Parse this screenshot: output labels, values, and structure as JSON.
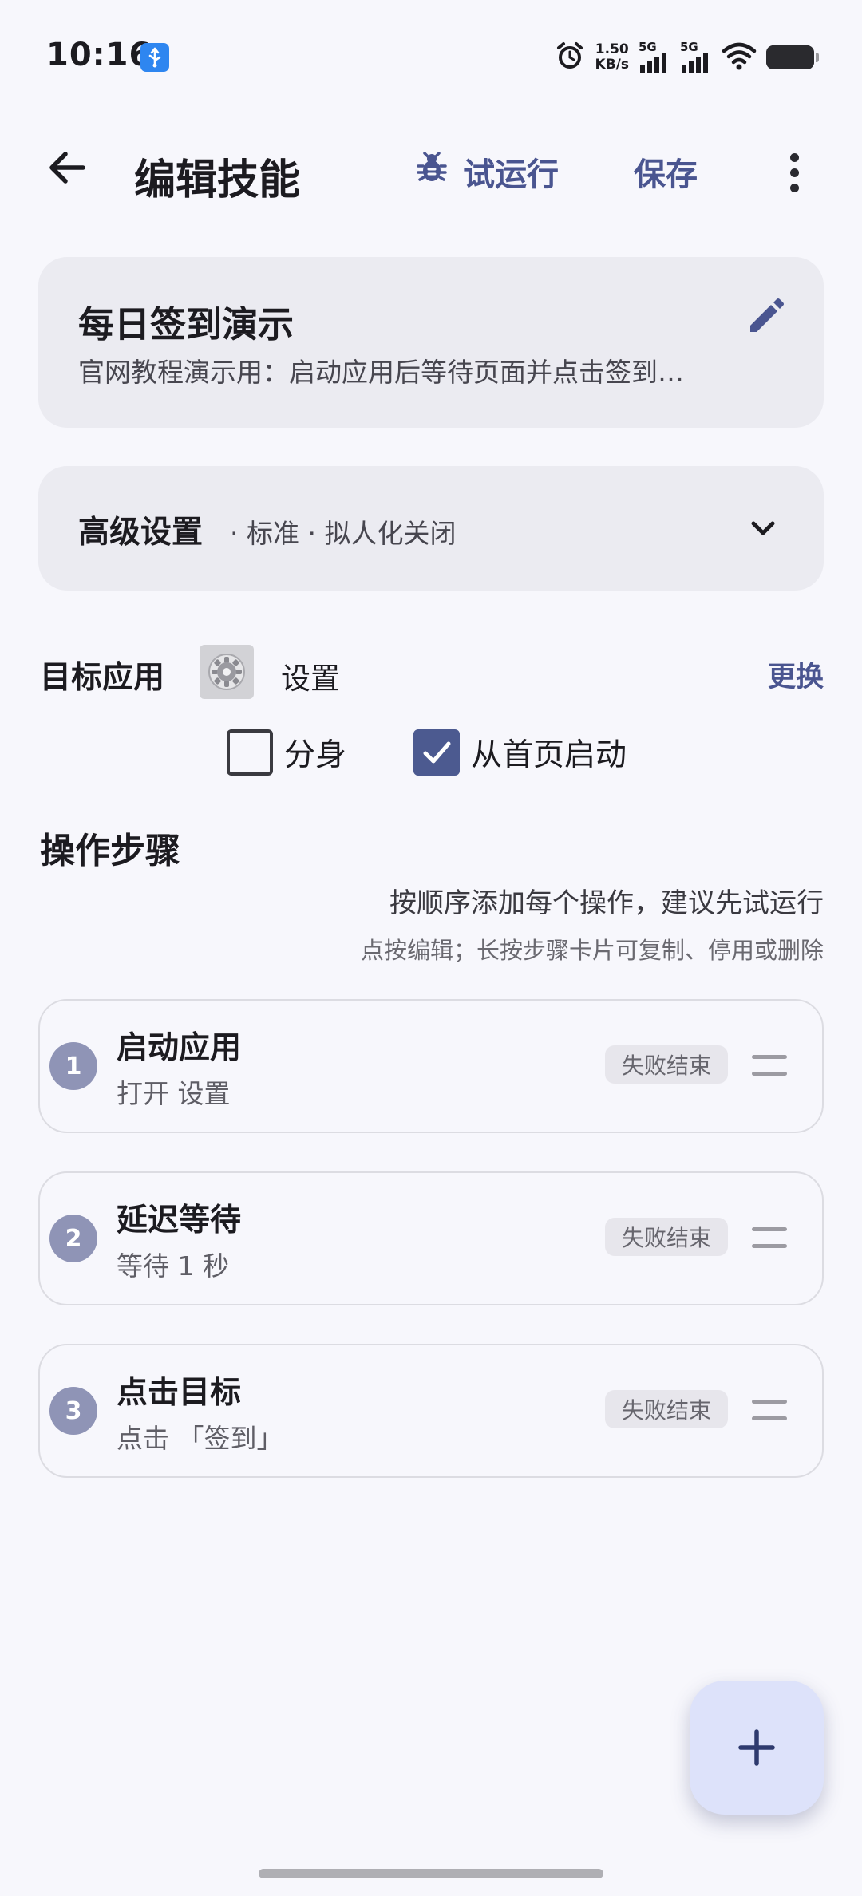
{
  "status_bar": {
    "time": "10:16",
    "speed_value": "1.50",
    "speed_unit": "KB/s",
    "sim1_label": "5G",
    "sim2_label": "5G"
  },
  "toolbar": {
    "title": "编辑技能",
    "trial_run_label": "试运行",
    "save_label": "保存"
  },
  "skill": {
    "name": "每日签到演示",
    "description": "官网教程演示用：启动应用后等待页面并点击签到…"
  },
  "advanced": {
    "title": "高级设置",
    "summary": "· 标准 · 拟人化关闭"
  },
  "target_app": {
    "label": "目标应用",
    "app_name": "设置",
    "change_label": "更换",
    "clone_label": "分身",
    "clone_checked": false,
    "from_home_label": "从首页启动",
    "from_home_checked": true
  },
  "steps": {
    "title": "操作步骤",
    "hint_primary": "按顺序添加每个操作，建议先试运行",
    "hint_secondary": "点按编辑；长按步骤卡片可复制、停用或删除",
    "items": [
      {
        "number": "1",
        "title": "启动应用",
        "desc": "打开 设置",
        "badge": "失败结束"
      },
      {
        "number": "2",
        "title": "延迟等待",
        "desc": "等待 1 秒",
        "badge": "失败结束"
      },
      {
        "number": "3",
        "title": "点击目标",
        "desc": "点击 「签到」",
        "badge": "失败结束"
      }
    ]
  },
  "colors": {
    "accent": "#4A5590",
    "background": "#F7F7FC",
    "card": "#EBEBF1",
    "fab": "#DDE2FA",
    "step_number": "#8F94B6"
  }
}
